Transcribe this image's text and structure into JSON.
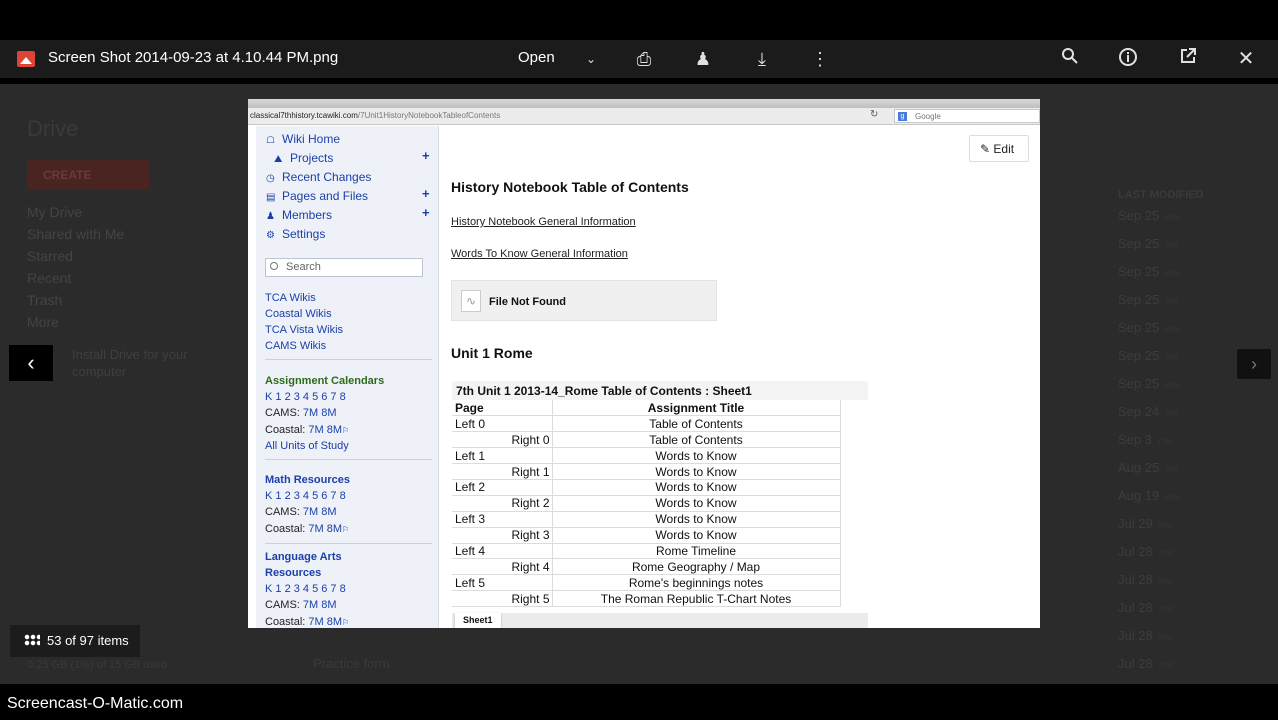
{
  "topbar": {
    "file_name": "Screen Shot 2014-09-23 at 4.10.44 PM.png",
    "open_label": "Open",
    "icons": [
      "image-icon",
      "chevron-down-icon",
      "print-icon",
      "add-person-icon",
      "download-icon",
      "more-vert-icon",
      "zoom-icon",
      "info-icon",
      "open-in-new-icon",
      "close-icon"
    ]
  },
  "background": {
    "app_title": "Drive",
    "create_label": "CREATE",
    "nav": [
      "My Drive",
      "Shared with Me",
      "Starred",
      "Recent",
      "Trash",
      "More"
    ],
    "install_text": "Install Drive for your computer",
    "last_modified": "LAST MODIFIED",
    "dates": [
      {
        "date": "Sep 25",
        "who": "me"
      },
      {
        "date": "Sep 25",
        "who": "me"
      },
      {
        "date": "Sep 25",
        "who": "me"
      },
      {
        "date": "Sep 25",
        "who": "me"
      },
      {
        "date": "Sep 25",
        "who": "me"
      },
      {
        "date": "Sep 25",
        "who": "me"
      },
      {
        "date": "Sep 25",
        "who": "me"
      },
      {
        "date": "Sep 24",
        "who": "me"
      },
      {
        "date": "Sep 3",
        "who": "me"
      },
      {
        "date": "Aug 25",
        "who": "me"
      },
      {
        "date": "Aug 19",
        "who": "me"
      },
      {
        "date": "Jul 29",
        "who": "me"
      },
      {
        "date": "Jul 28",
        "who": "me"
      },
      {
        "date": "Jul 28",
        "who": "me"
      },
      {
        "date": "Jul 28",
        "who": "me"
      },
      {
        "date": "Jul 28",
        "who": "me"
      },
      {
        "date": "Jul 28",
        "who": "me"
      }
    ],
    "practice_form": "Practice form",
    "storage": "0.25 GB (1%) of 15 GB used"
  },
  "viewer": {
    "items_counter": "53 of 97 items"
  },
  "watermark": "Screencast-O-Matic.com",
  "screenshot": {
    "url_domain": "classical7thhistory.tcawiki.com",
    "url_path": "/7Unit1HistoryNotebookTableofContents",
    "search_engine": "Google",
    "sidebar": {
      "nav": {
        "wiki_home": "Wiki Home",
        "projects": "Projects",
        "recent_changes": "Recent Changes",
        "pages_files": "Pages and Files",
        "members": "Members",
        "settings": "Settings"
      },
      "search_placeholder": "Search",
      "wikis": [
        "TCA Wikis",
        "Coastal Wikis",
        "TCA Vista Wikis",
        "CAMS Wikis"
      ],
      "assignment": {
        "heading": "Assignment Calendars",
        "grades": "K 1 2 3 4 5 6 7 8",
        "cams_label": "CAMS:",
        "cams_links": "7M 8M",
        "coastal_label": "Coastal:",
        "coastal_links": "7M 8M",
        "all_units": "All Units of Study"
      },
      "math": {
        "heading": "Math Resources",
        "grades": "K 1 2 3 4 5 6 7 8",
        "cams_label": "CAMS:",
        "cams_links": "7M 8M",
        "coastal_label": "Coastal:",
        "coastal_links": "7M 8M"
      },
      "lang": {
        "heading1": "Language Arts",
        "heading2": "Resources",
        "grades": "K 1 2 3 4 5 6 7 8",
        "cams_label": "CAMS:",
        "cams_links": "7M 8M",
        "coastal_label": "Coastal:",
        "coastal_links": "7M 8M"
      }
    },
    "content": {
      "edit_label": "Edit",
      "title": "History Notebook Table of Contents",
      "link1": "History Notebook General Information",
      "link2": "Words To Know General Information",
      "file_not_found": "File Not Found",
      "unit_heading": "Unit 1 Rome",
      "sheet_title": "7th Unit 1 2013-14_Rome Table of Contents : Sheet1",
      "col_page": "Page",
      "col_title": "Assignment Title",
      "rows": [
        {
          "page": "Left 0",
          "side": "left",
          "title": "Table of Contents"
        },
        {
          "page": "Right 0",
          "side": "right",
          "title": "Table of Contents"
        },
        {
          "page": "Left 1",
          "side": "left",
          "title": "Words to Know"
        },
        {
          "page": "Right 1",
          "side": "right",
          "title": "Words to Know"
        },
        {
          "page": "Left 2",
          "side": "left",
          "title": "Words to Know"
        },
        {
          "page": "Right 2",
          "side": "right",
          "title": "Words to Know"
        },
        {
          "page": "Left 3",
          "side": "left",
          "title": "Words to Know"
        },
        {
          "page": "Right 3",
          "side": "right",
          "title": "Words to Know"
        },
        {
          "page": "Left 4",
          "side": "left",
          "title": "Rome Timeline"
        },
        {
          "page": "Right 4",
          "side": "right",
          "title": "Rome Geography / Map"
        },
        {
          "page": "Left 5",
          "side": "left",
          "title": "Rome's beginnings notes"
        },
        {
          "page": "Right 5",
          "side": "right",
          "title": "The Roman Republic T-Chart Notes"
        }
      ],
      "sheet_tab": "Sheet1"
    }
  }
}
